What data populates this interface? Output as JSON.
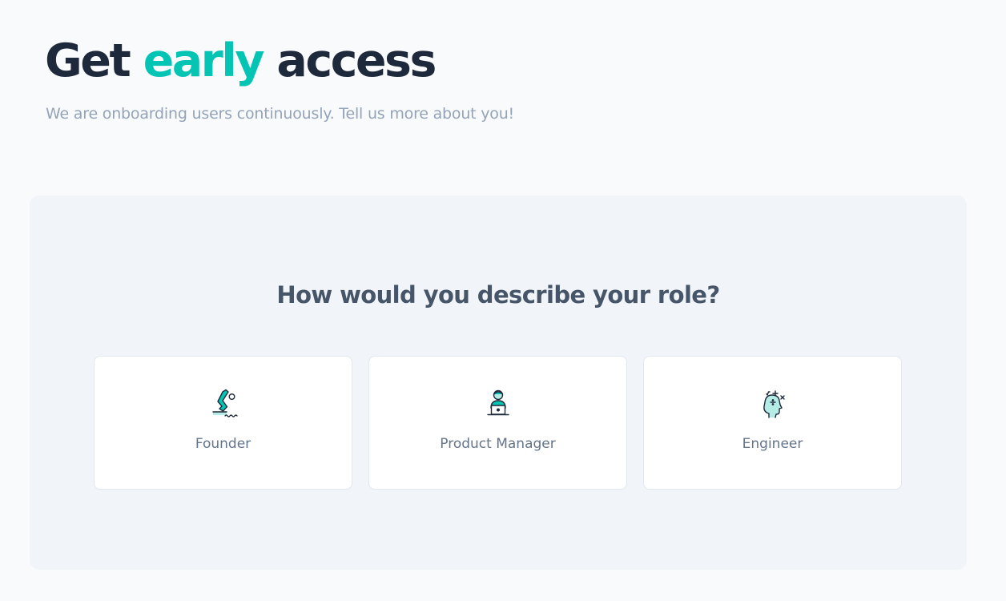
{
  "header": {
    "title_prefix": "Get",
    "title_accent": "early",
    "title_suffix": "access",
    "subtitle": "We are onboarding users continuously. Tell us more about you!"
  },
  "role_section": {
    "question": "How would you describe your role?",
    "options": [
      {
        "label": "Founder",
        "icon": "diver-icon"
      },
      {
        "label": "Product Manager",
        "icon": "person-laptop-icon"
      },
      {
        "label": "Engineer",
        "icon": "head-math-icon"
      }
    ]
  },
  "colors": {
    "accent": "#04c4b4",
    "title": "#1e293b",
    "subtitle": "#94a3b8",
    "question": "#475569",
    "card_label": "#64748b",
    "panel_bg": "#f1f4f8",
    "page_bg": "#f8fafc"
  }
}
